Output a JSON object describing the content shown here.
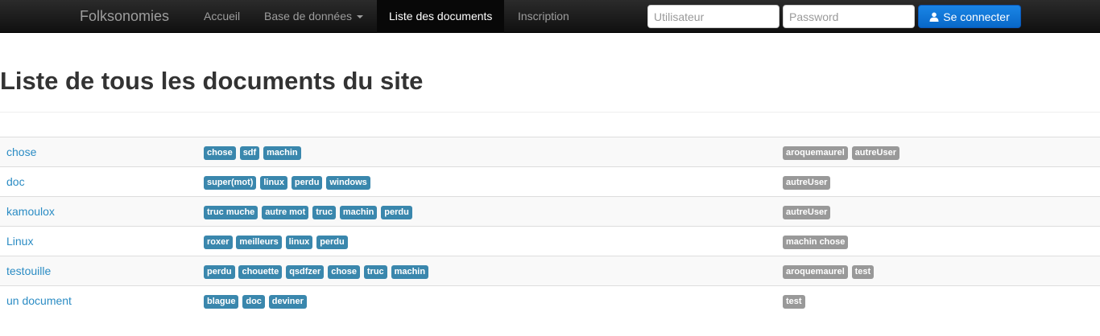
{
  "colors": {
    "tag": "#3a87ad",
    "user": "#999999",
    "link": "#2b8cc4",
    "primary": "#0868c8",
    "navbar": "#1b1b1b"
  },
  "navbar": {
    "brand": "Folksonomies",
    "items": [
      {
        "label": "Accueil",
        "active": false
      },
      {
        "label": "Base de données",
        "active": false,
        "dropdown": true
      },
      {
        "label": "Liste des documents",
        "active": true
      },
      {
        "label": "Inscription",
        "active": false
      }
    ],
    "login": {
      "user_placeholder": "Utilisateur",
      "password_placeholder": "Password",
      "submit_label": "Se connecter",
      "submit_icon": "user-icon"
    }
  },
  "page": {
    "title": "Liste de tous les documents du site"
  },
  "documents": [
    {
      "name": "chose",
      "tags": [
        "chose",
        "sdf",
        "machin"
      ],
      "users": [
        "aroquemaurel",
        "autreUser"
      ]
    },
    {
      "name": "doc",
      "tags": [
        "super(mot)",
        "linux",
        "perdu",
        "windows"
      ],
      "users": [
        "autreUser"
      ]
    },
    {
      "name": "kamoulox",
      "tags": [
        "truc muche",
        "autre mot",
        "truc",
        "machin",
        "perdu"
      ],
      "users": [
        "autreUser"
      ]
    },
    {
      "name": "Linux",
      "tags": [
        "roxer",
        "meilleurs",
        "linux",
        "perdu"
      ],
      "users": [
        "machin chose"
      ]
    },
    {
      "name": "testouille",
      "tags": [
        "perdu",
        "chouette",
        "qsdfzer",
        "chose",
        "truc",
        "machin"
      ],
      "users": [
        "aroquemaurel",
        "test"
      ]
    },
    {
      "name": "un document",
      "tags": [
        "blague",
        "doc",
        "deviner"
      ],
      "users": [
        "test"
      ]
    }
  ]
}
